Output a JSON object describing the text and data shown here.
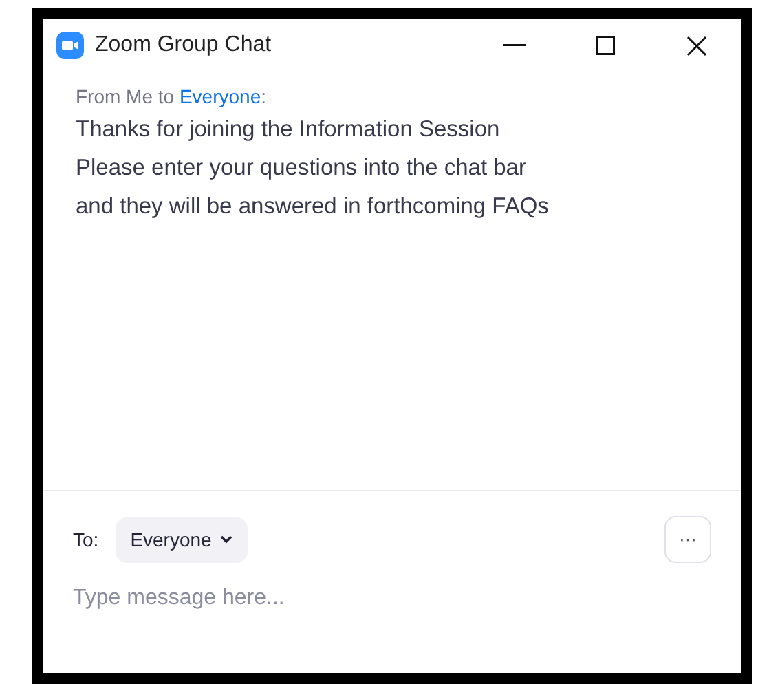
{
  "window": {
    "title": "Zoom Group Chat"
  },
  "message": {
    "prefix": "From Me to",
    "recipient": "Everyone",
    "suffix": ":",
    "lines": [
      "Thanks for joining the Information Session",
      "Please enter your questions into the chat bar",
      "and they will be answered in forthcoming FAQs"
    ]
  },
  "composer": {
    "to_label": "To:",
    "recipient": "Everyone",
    "more": "···",
    "placeholder": "Type message here..."
  }
}
